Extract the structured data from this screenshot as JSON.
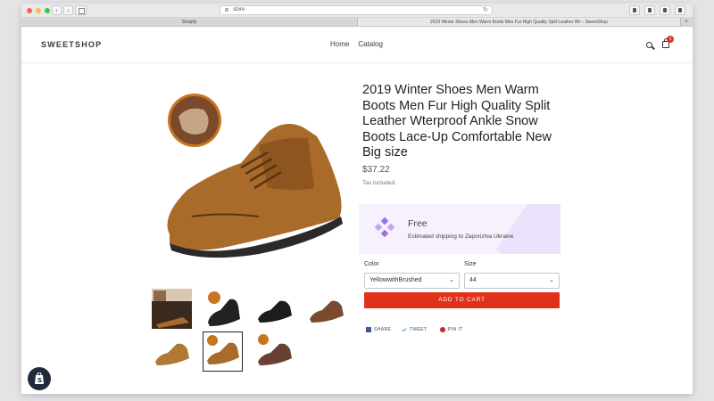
{
  "browser": {
    "url": "store",
    "tabs": [
      {
        "label": "Shopify"
      },
      {
        "label": "2019 Winter Shoes Men Warm Boots Men Fur High Quality Split Leather Wt – SweetShop"
      }
    ],
    "new_tab_label": "+"
  },
  "store": {
    "logo": "SWEETSHOP",
    "nav": [
      "Home",
      "Catalog"
    ],
    "cart_count": "1"
  },
  "product": {
    "title": "2019 Winter Shoes Men Warm Boots Men Fur High Quality Split Leather Wterproof Ankle Snow Boots Lace-Up Comfortable New Big size",
    "price": "$37.22",
    "tax_note": "Tax included.",
    "shipping": {
      "title": "Free",
      "subtitle": "Estimated shipping to Zaporizhia Ukraine"
    },
    "color_label": "Color",
    "color_value": "YellowwithBrushed",
    "size_label": "Size",
    "size_value": "44",
    "add_to_cart": "ADD TO CART",
    "share": [
      "SHARE",
      "TWEET",
      "PIN IT"
    ],
    "selected_thumbnail": 6
  },
  "colors": {
    "accent": "#e0321a",
    "shipping_bg": "#f6f1fd",
    "diamond": "#9b6fe0"
  }
}
